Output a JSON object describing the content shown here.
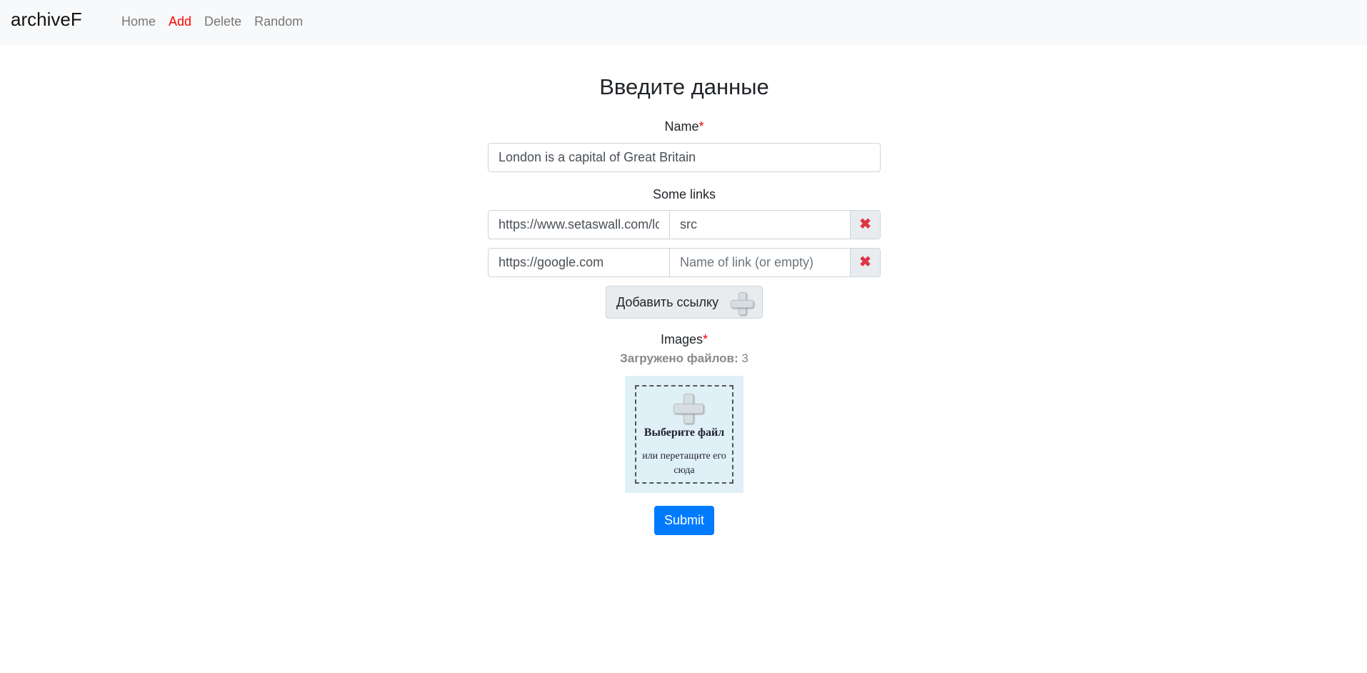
{
  "navbar": {
    "brand": "archiveF",
    "links": [
      "Home",
      "Add",
      "Delete",
      "Random"
    ],
    "active": "Add"
  },
  "form": {
    "title": "Введите данные",
    "name_label": "Name",
    "required_mark": "*",
    "name_value": "London is a capital of Great Britain",
    "links_label": "Some links",
    "links": [
      {
        "url": "https://www.setaswall.com/lon",
        "name": "src"
      },
      {
        "url": "https://google.com",
        "name": ""
      }
    ],
    "link_name_placeholder": "Name of link (or empty)",
    "remove_icon": "✖",
    "add_link_label": "Добавить ссылку",
    "images_label": "Images",
    "uploaded_label": "Загружено файлов:",
    "uploaded_count": "3",
    "drop_title": "Выберите файл",
    "drop_subtitle": "или перетащите его сюда",
    "submit_label": "Submit"
  },
  "colors": {
    "active_link": "#ff0000",
    "primary": "#007bff",
    "remove": "#dc3545",
    "dropzone": "#e0f0f7"
  }
}
